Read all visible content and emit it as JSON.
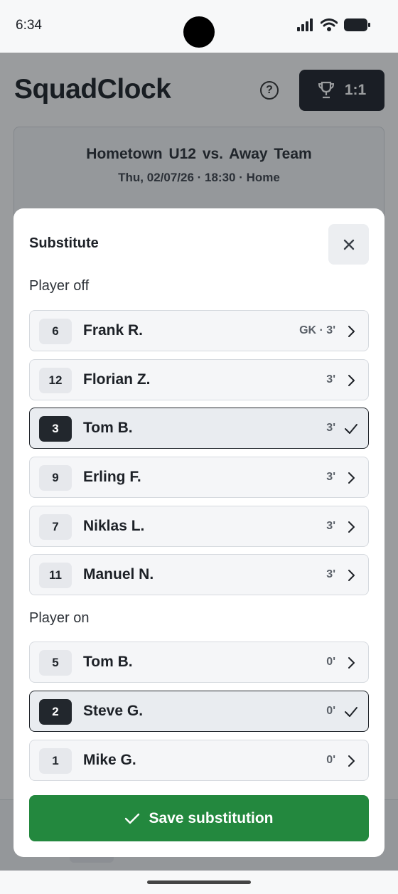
{
  "status_bar": {
    "time": "6:34"
  },
  "app": {
    "title": "SquadClock",
    "score": "1:1",
    "match": {
      "home_team": "Hometown U12",
      "vs": "vs.",
      "away_team": "Away Team",
      "meta": "Thu, 02/07/26 · 18:30 · Home"
    }
  },
  "sheet": {
    "title": "Substitute",
    "player_off_label": "Player off",
    "player_on_label": "Player on",
    "players_off": [
      {
        "number": "6",
        "name": "Frank R.",
        "info": "GK · 3'",
        "selected": false
      },
      {
        "number": "12",
        "name": "Florian Z.",
        "info": "3'",
        "selected": false
      },
      {
        "number": "3",
        "name": "Tom B.",
        "info": "3'",
        "selected": true
      },
      {
        "number": "9",
        "name": "Erling F.",
        "info": "3'",
        "selected": false
      },
      {
        "number": "7",
        "name": "Niklas L.",
        "info": "3'",
        "selected": false
      },
      {
        "number": "11",
        "name": "Manuel N.",
        "info": "3'",
        "selected": false
      }
    ],
    "players_on": [
      {
        "number": "5",
        "name": "Tom B.",
        "info": "0'",
        "selected": false
      },
      {
        "number": "2",
        "name": "Steve G.",
        "info": "0'",
        "selected": true
      },
      {
        "number": "1",
        "name": "Mike G.",
        "info": "0'",
        "selected": false
      }
    ],
    "save_label": "Save substitution"
  },
  "icons": {
    "close": "close-icon",
    "chevron": "chevron-right-icon",
    "check": "check-icon",
    "trophy": "trophy-icon",
    "help": "help-icon"
  },
  "colors": {
    "accent": "#23883e",
    "dark": "#1f242b",
    "selected_bg": "#e9ecf0"
  }
}
